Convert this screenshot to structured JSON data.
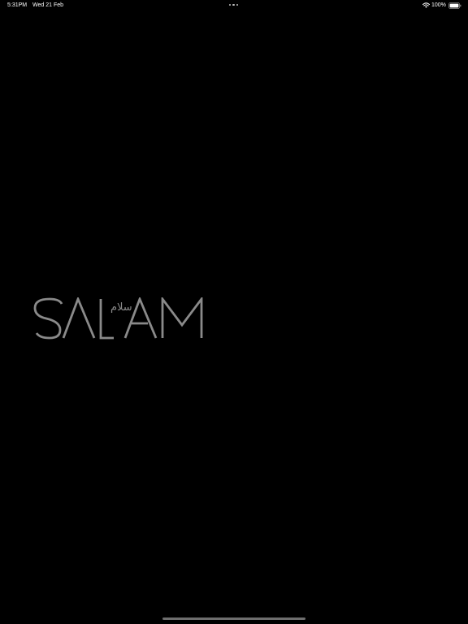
{
  "status_bar": {
    "time": "5:31PM",
    "date": "Wed 21 Feb",
    "battery_percent": "100%",
    "wifi_icon": "wifi-icon",
    "battery_icon": "battery-full-icon",
    "multitask_icon": "multitask-dots-icon"
  },
  "splash": {
    "logo_text": "SALAM",
    "arabic_text": "سلام",
    "logo_color": "#8a8a8a",
    "background_color": "#000000"
  }
}
